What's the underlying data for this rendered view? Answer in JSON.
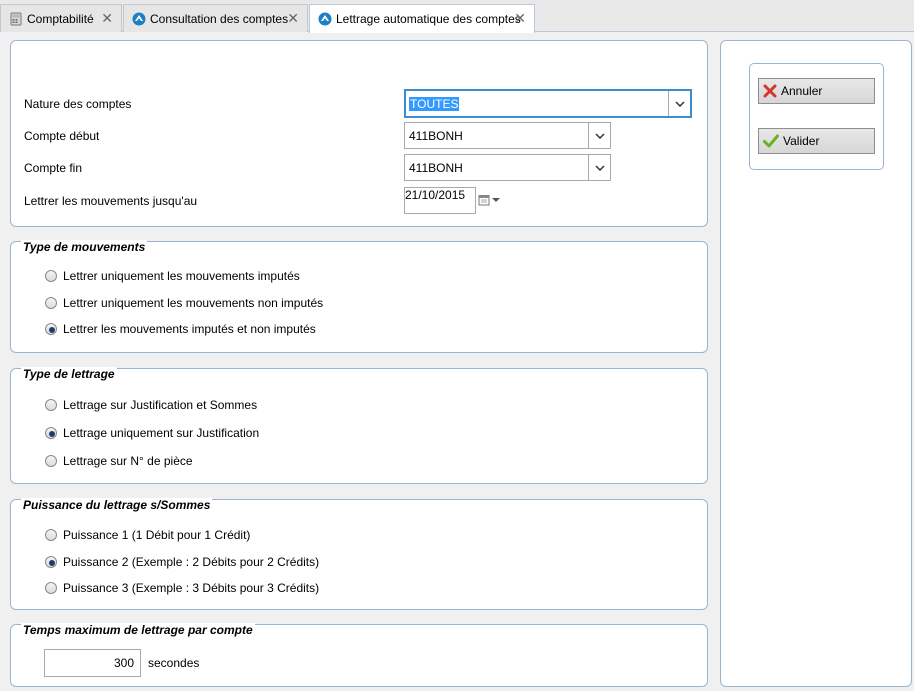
{
  "tabs": [
    {
      "label": "Comptabilité",
      "icon": "calculator-icon"
    },
    {
      "label": "Consultation des comptes",
      "icon": "app-icon"
    },
    {
      "label": "Lettrage automatique des comptes",
      "icon": "app-icon"
    }
  ],
  "form": {
    "nature_label": "Nature des comptes",
    "nature_value": "TOUTES",
    "compte_debut_label": "Compte début",
    "compte_debut_value": "411BONH",
    "compte_fin_label": "Compte fin",
    "compte_fin_value": "411BONH",
    "lettrer_label": "Lettrer  les mouvements jusqu'au",
    "lettrer_date": "21/10/2015"
  },
  "type_mouvements": {
    "title": "Type de mouvements",
    "options": [
      "Lettrer uniquement les mouvements imputés",
      "Lettrer uniquement les mouvements non imputés",
      "Lettrer les mouvements imputés et non imputés"
    ],
    "selected_index": 2
  },
  "type_lettrage": {
    "title": "Type de lettrage",
    "options": [
      "Lettrage sur Justification et Sommes",
      "Lettrage uniquement sur Justification",
      "Lettrage sur N° de pièce"
    ],
    "selected_index": 1
  },
  "puissance": {
    "title": "Puissance du lettrage s/Sommes",
    "options": [
      "Puissance 1  (1 Débit pour 1 Crédit)",
      "Puissance 2  (Exemple : 2 Débits pour 2 Crédits)",
      "Puissance 3  (Exemple : 3 Débits pour 3 Crédits)"
    ],
    "selected_index": 1
  },
  "temps": {
    "title": "Temps maximum de lettrage par compte",
    "value": "300",
    "unit": "secondes"
  },
  "actions": {
    "cancel_label": "Annuler",
    "validate_label": "Valider"
  },
  "colors": {
    "border": "#9db4d0",
    "selection": "#3399ff",
    "focus": "#3c8dd0",
    "cancel_icon": "#d9342b",
    "validate_icon": "#6ab023"
  }
}
